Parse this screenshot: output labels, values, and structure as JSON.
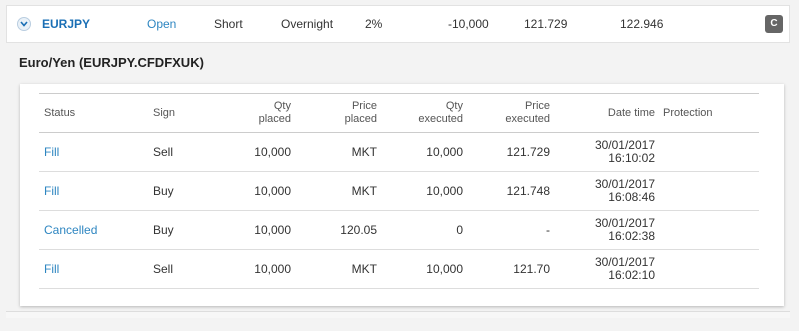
{
  "position": {
    "symbol": "EURJPY",
    "status": "Open",
    "side": "Short",
    "type": "Overnight",
    "percent": "2%",
    "quantity": "-10,000",
    "price_open": "121.729",
    "price_current": "122.946",
    "close_button_label": "C"
  },
  "detail": {
    "title": "Euro/Yen (EURJPY.CFDFXUK)",
    "columns": {
      "status": "Status",
      "sign": "Sign",
      "qty_placed_1": "Qty",
      "qty_placed_2": "placed",
      "price_placed_1": "Price",
      "price_placed_2": "placed",
      "qty_executed_1": "Qty",
      "qty_executed_2": "executed",
      "price_executed_1": "Price",
      "price_executed_2": "executed",
      "date_time": "Date time",
      "protection": "Protection"
    },
    "orders": [
      {
        "status": "Fill",
        "sign": "Sell",
        "qty_placed": "10,000",
        "price_placed": "MKT",
        "qty_executed": "10,000",
        "price_executed": "121.729",
        "date": "30/01/2017",
        "time": "16:10:02",
        "protection": ""
      },
      {
        "status": "Fill",
        "sign": "Buy",
        "qty_placed": "10,000",
        "price_placed": "MKT",
        "qty_executed": "10,000",
        "price_executed": "121.748",
        "date": "30/01/2017",
        "time": "16:08:46",
        "protection": ""
      },
      {
        "status": "Cancelled",
        "sign": "Buy",
        "qty_placed": "10,000",
        "price_placed": "120.05",
        "qty_executed": "0",
        "price_executed": "-",
        "date": "30/01/2017",
        "time": "16:02:38",
        "protection": ""
      },
      {
        "status": "Fill",
        "sign": "Sell",
        "qty_placed": "10,000",
        "price_placed": "MKT",
        "qty_executed": "10,000",
        "price_executed": "121.70",
        "date": "30/01/2017",
        "time": "16:02:10",
        "protection": ""
      }
    ]
  }
}
